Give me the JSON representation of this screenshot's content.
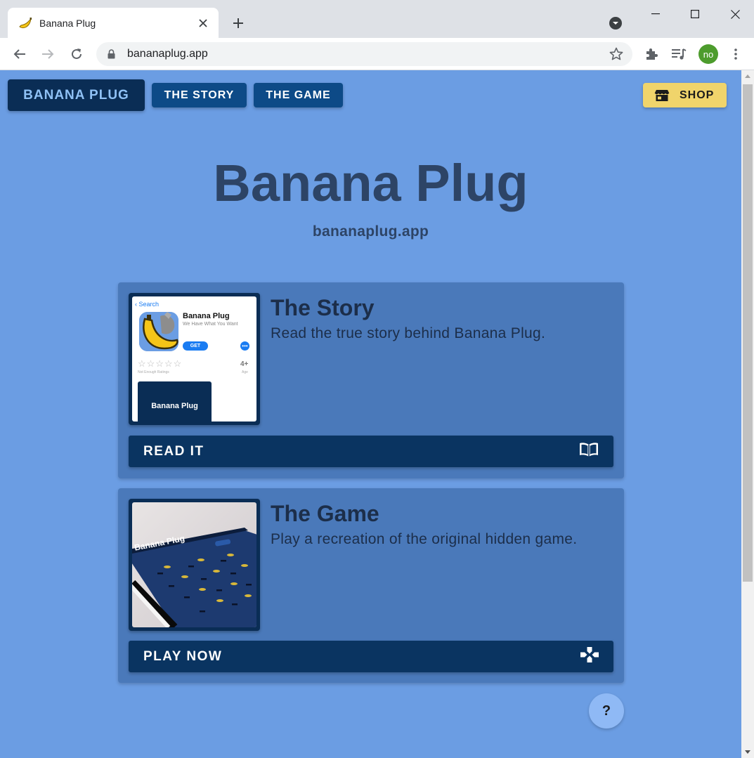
{
  "browser": {
    "tab_title": "Banana Plug",
    "url": "bananaplug.app",
    "profile_initials": "no"
  },
  "nav": {
    "brand": "BANANA PLUG",
    "story": "THE STORY",
    "game": "THE GAME",
    "shop": "SHOP"
  },
  "hero": {
    "title": "Banana Plug",
    "subtitle": "bananaplug.app"
  },
  "cards": [
    {
      "title": "The Story",
      "description": "Read the true story behind Banana Plug.",
      "action": "READ IT",
      "icon": "book-icon",
      "thumbnail": {
        "back_label": "Search",
        "app_name": "Banana Plug",
        "tagline": "We Have What You Want",
        "get_label": "GET",
        "more_label": "•••",
        "stars": "☆☆☆☆☆",
        "rating_note": "Not Enough Ratings",
        "age": "4+",
        "age_label": "Age",
        "screenshot_title": "Banana Plug"
      }
    },
    {
      "title": "The Game",
      "description": "Play a recreation of the original hidden game.",
      "action": "PLAY NOW",
      "icon": "gamepad-icon",
      "thumbnail": {
        "device_label": "Banana Plug"
      }
    }
  ],
  "help": "?",
  "colors": {
    "page_bg": "#6b9de3",
    "card_bg": "#4a79ba",
    "navy": "#0a2d55",
    "shop_yellow": "#f0d46b"
  }
}
